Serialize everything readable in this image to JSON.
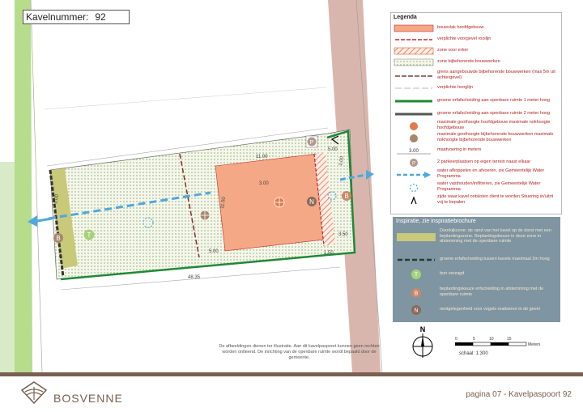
{
  "header": {
    "label": "Kavelnummer:",
    "number": "92"
  },
  "dimensions": {
    "top_width": "5.00",
    "lower_width": "3.50",
    "side_depth": "1.50",
    "plot_right_small": "1.00",
    "left_plot_depth": "1.00",
    "bottom_length": "48.35",
    "building_side": "11.50",
    "top_band": "11.00",
    "middle_band": "3.00",
    "bottom_band": "5.00"
  },
  "legend": {
    "title": "Legenda",
    "items": [
      {
        "label": "bouwvlak hoofdgebouw"
      },
      {
        "label": "verplichte voorgevel rooilijn"
      },
      {
        "label": "zone voor erker"
      },
      {
        "label": "zone bijbehorende bouwwerken"
      },
      {
        "label": "grens aangebouwde bijbehorende bouwwerken (max 5m uit achtergevel)"
      },
      {
        "label": "verplichte hooglijn"
      },
      {
        "label": "groene erfafscheiding aan openbare ruimte 1 meter hoog"
      },
      {
        "label": "groene erfafscheiding aan openbare ruimte 2 meter hoog"
      },
      {
        "label": "maximale goothoogte hoofdgebouw maximale nokhoogte hoofdgebouw"
      },
      {
        "label": "maximale goothoogte bijbehorende bouwwerken maximale nokhoogte bijbehorende bouwwerken"
      },
      {
        "label": "maatvoering in meters",
        "sample": "3.00"
      },
      {
        "label": "2 parkeerplaatsen op eigen terrein naast elkaar",
        "badge": "P"
      },
      {
        "label": "water afkoppelen en afvoeren, zie Gemeentelijk Water Programma"
      },
      {
        "label": "water vasthouden/infiltreren, zie Gemeentelijk Water Programma"
      },
      {
        "label": "zijde waar kavel ontsloten dient te worden Situering in/uitrit vrij te bepalen"
      }
    ]
  },
  "inspiration": {
    "title": "Inspiratie, zie inspiratiebrochure",
    "items": [
      {
        "label": "Doorkijkzone: de rand van het kavel op de dorst met een beplantingszone. Beplantingskeuze in deze zone in afstemming met de openbare ruimte"
      },
      {
        "label": "groene erfafscheiding tussen kavels maximaal 2m hoog"
      },
      {
        "label": "bon verzagd",
        "badge": "T"
      },
      {
        "label": "beplantingskeuze erfscheiding in afstemming met de openbare ruimte",
        "badge": "B"
      },
      {
        "label": "nestgelegenheid voor vogels realiseren in de gevel",
        "badge": "N"
      }
    ]
  },
  "compass": {
    "letter": "N"
  },
  "scale": {
    "label": "schaal: 1:300",
    "ticks": [
      "0",
      "5",
      "10",
      "15"
    ],
    "unit": "Meters"
  },
  "disclaimer": "De afbeeldingen dienen ter illustratie. Aan dit kavelpaspoort kunnen geen rechten worden ontleend. De inrichting van de openbare ruimte wordt bepaald door de gemeente.",
  "footer": {
    "brand": "BOSVENNE",
    "page": "pagina 07 - Kavelpaspoort 92"
  },
  "colors": {
    "building": "#f4a885",
    "road": "#d9b6ad",
    "grass": "#a6d27a",
    "green_fence": "#1e8a36",
    "panel": "#7f95a2",
    "brand": "#7a6052",
    "water": "#4ea8dc",
    "red_line": "#c0282f"
  },
  "icons": [
    "compass-icon",
    "bosvenne-logo",
    "arrow-right-icon",
    "arrow-left-icon",
    "height-marker-icon"
  ]
}
